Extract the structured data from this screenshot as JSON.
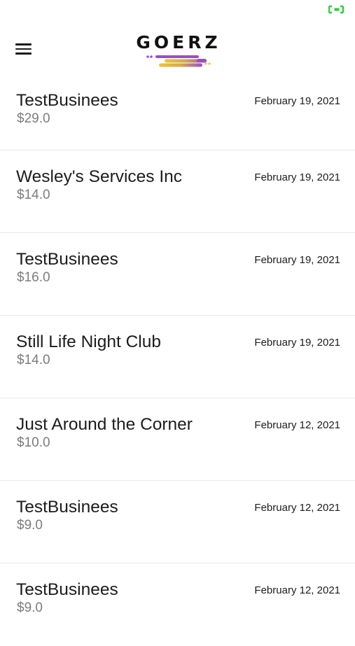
{
  "status_bar": {
    "battery_icon": "battery-icon",
    "battery_color": "#2ecc40"
  },
  "header": {
    "menu_icon": "hamburger-menu-icon",
    "logo_text": "GOERZ",
    "logo_colors": [
      "#9b4dcc",
      "#f2c233"
    ]
  },
  "transactions": [
    {
      "name": "TestBusinees",
      "price": "$29.0",
      "date": "February 19, 2021"
    },
    {
      "name": "Wesley's Services Inc",
      "price": "$14.0",
      "date": "February 19, 2021"
    },
    {
      "name": "TestBusinees",
      "price": "$16.0",
      "date": "February 19, 2021"
    },
    {
      "name": "Still Life Night Club",
      "price": "$14.0",
      "date": "February 19, 2021"
    },
    {
      "name": "Just Around the Corner",
      "price": "$10.0",
      "date": "February 12, 2021"
    },
    {
      "name": "TestBusinees",
      "price": "$9.0",
      "date": "February 12, 2021"
    },
    {
      "name": "TestBusinees",
      "price": "$9.0",
      "date": "February 12, 2021"
    }
  ]
}
